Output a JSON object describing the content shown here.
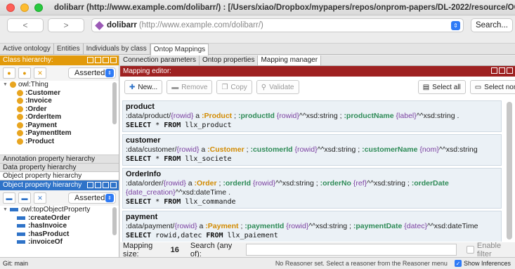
{
  "window": {
    "title": "dolibarr (http://www.example.com/dolibarr/)  : [/Users/xiao/Dropbox/mypapers/repos/onprom-papers/DL-2022/resource/OCELERP.owl]"
  },
  "toolbar": {
    "back_label": "<",
    "forward_label": ">",
    "ontology_name": "dolibarr",
    "ontology_iri": "(http://www.example.com/dolibarr/)",
    "search_label": "Search..."
  },
  "top_tabs": [
    "Active ontology",
    "Entities",
    "Individuals by class",
    "Ontop Mappings"
  ],
  "class_hierarchy": {
    "header": "Class hierarchy:",
    "mode": "Asserted",
    "root": "owl:Thing",
    "items": [
      ":Customer",
      ":Invoice",
      ":Order",
      ":OrderItem",
      ":Payment",
      ":PaymentItem",
      ":Product"
    ]
  },
  "hierarchy_tabs": [
    "Annotation property hierarchy",
    "Data property hierarchy",
    "Object property hierarchy"
  ],
  "object_property_hierarchy": {
    "header": "Object property hierarchy",
    "mode": "Asserted",
    "root": "owl:topObjectProperty",
    "items": [
      ":createOrder",
      ":hasInvoice",
      ":hasProduct",
      ":invoiceOf"
    ]
  },
  "sub_tabs": [
    "Connection parameters",
    "Ontop properties",
    "Mapping manager"
  ],
  "mapping_editor": {
    "header": "Mapping editor:",
    "buttons": {
      "new": "New...",
      "remove": "Remove",
      "copy": "Copy",
      "validate": "Validate",
      "select_all": "Select all",
      "select_none": "Select none"
    },
    "mappings": [
      {
        "name": "product",
        "target_parts": [
          [
            ":data/product/",
            "v-black"
          ],
          [
            "{rowid}",
            "v-purple"
          ],
          [
            " a ",
            "v-black"
          ],
          [
            ":Product",
            "v-orange"
          ],
          [
            " ; ",
            "v-black"
          ],
          [
            ":productId",
            "v-green"
          ],
          [
            " ",
            "v-black"
          ],
          [
            "{rowid}",
            "v-purple"
          ],
          [
            "^^xsd:string ; ",
            "v-black"
          ],
          [
            ":productName",
            "v-green"
          ],
          [
            " ",
            "v-black"
          ],
          [
            "{label}",
            "v-purple"
          ],
          [
            "^^xsd:string .",
            "v-black"
          ]
        ],
        "source_kw1": "SELECT",
        "source_mid": " * ",
        "source_kw2": "FROM",
        "source_rest": " llx_product"
      },
      {
        "name": "customer",
        "target_parts": [
          [
            ":data/customer/",
            "v-black"
          ],
          [
            "{rowid}",
            "v-purple"
          ],
          [
            " a ",
            "v-black"
          ],
          [
            ":Customer",
            "v-orange"
          ],
          [
            " ; ",
            "v-black"
          ],
          [
            ":customerId",
            "v-green"
          ],
          [
            " ",
            "v-black"
          ],
          [
            "{rowid}",
            "v-purple"
          ],
          [
            "^^xsd:string ; ",
            "v-black"
          ],
          [
            ":customerName",
            "v-green"
          ],
          [
            " ",
            "v-black"
          ],
          [
            "{nom}",
            "v-purple"
          ],
          [
            "^^xsd:string",
            "v-black"
          ]
        ],
        "source_kw1": "SELECT",
        "source_mid": " * ",
        "source_kw2": "FROM",
        "source_rest": " llx_societe"
      },
      {
        "name": "OrderInfo",
        "target_parts": [
          [
            ":data/order/",
            "v-black"
          ],
          [
            "{rowid}",
            "v-purple"
          ],
          [
            " a ",
            "v-black"
          ],
          [
            ":Order",
            "v-orange"
          ],
          [
            " ; ",
            "v-black"
          ],
          [
            ":orderId",
            "v-green"
          ],
          [
            " ",
            "v-black"
          ],
          [
            "{rowid}",
            "v-purple"
          ],
          [
            "^^xsd:string ; ",
            "v-black"
          ],
          [
            ":orderNo",
            "v-green"
          ],
          [
            " ",
            "v-black"
          ],
          [
            "{ref}",
            "v-purple"
          ],
          [
            "^^xsd:string ; ",
            "v-black"
          ],
          [
            ":orderDate",
            "v-green"
          ],
          [
            " ",
            "v-black"
          ],
          [
            "{date_creation}",
            "v-purple"
          ],
          [
            "^^xsd:dateTime .",
            "v-black"
          ]
        ],
        "source_kw1": "SELECT",
        "source_mid": " * ",
        "source_kw2": "FROM",
        "source_rest": " llx_commande"
      },
      {
        "name": "payment",
        "target_parts": [
          [
            ":data/payment/",
            "v-black"
          ],
          [
            "{rowid}",
            "v-purple"
          ],
          [
            " a ",
            "v-black"
          ],
          [
            ":Payment",
            "v-orange"
          ],
          [
            " ; ",
            "v-black"
          ],
          [
            ":paymentId",
            "v-green"
          ],
          [
            " ",
            "v-black"
          ],
          [
            "{rowid}",
            "v-purple"
          ],
          [
            "^^xsd:string ; ",
            "v-black"
          ],
          [
            ":paymentDate",
            "v-green"
          ],
          [
            " ",
            "v-black"
          ],
          [
            "{datec}",
            "v-purple"
          ],
          [
            "^^xsd:dateTime",
            "v-black"
          ]
        ],
        "source_kw1": "SELECT",
        "source_mid": " rowid,datec ",
        "source_kw2": "FROM",
        "source_rest": " llx_paiement"
      }
    ],
    "mapping_size_label": "Mapping size:",
    "mapping_size": "16",
    "search_label": "Search (any of):",
    "search_value": "",
    "enable_filter_label": "Enable filter"
  },
  "status_bar": {
    "git": "Git: main",
    "reasoner_message": "No Reasoner set. Select a reasoner from the Reasoner menu",
    "show_inferences_label": "Show Inferences"
  },
  "colors": {
    "class_header": "#e29a0b",
    "property_header": "#2f73c8",
    "mapping_header": "#9e2121",
    "class_dot": "#e8a520",
    "mapping_bg": "#ebf1f6"
  }
}
